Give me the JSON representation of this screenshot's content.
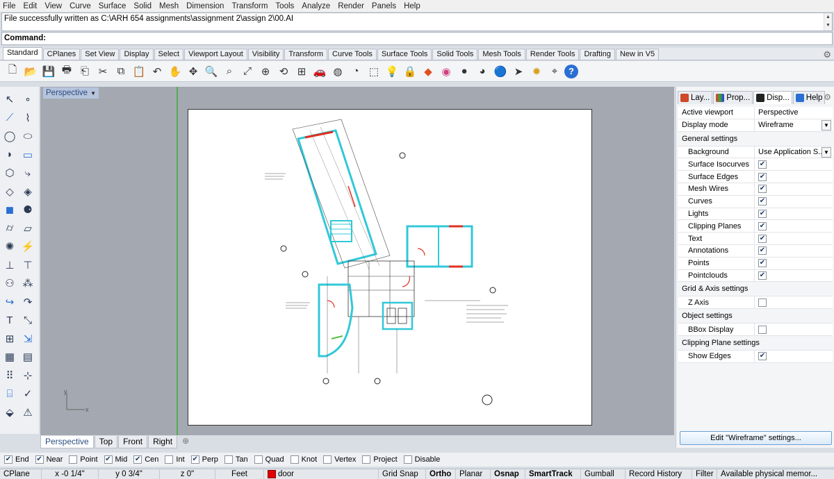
{
  "menu": [
    "File",
    "Edit",
    "View",
    "Curve",
    "Surface",
    "Solid",
    "Mesh",
    "Dimension",
    "Transform",
    "Tools",
    "Analyze",
    "Render",
    "Panels",
    "Help"
  ],
  "command_history": "File successfully written as C:\\ARH 654 assignments\\assignment 2\\assign 2\\00.AI",
  "command_prompt": "Command:",
  "toolbar_tabs": [
    "Standard",
    "CPlanes",
    "Set View",
    "Display",
    "Select",
    "Viewport Layout",
    "Visibility",
    "Transform",
    "Curve Tools",
    "Surface Tools",
    "Solid Tools",
    "Mesh Tools",
    "Render Tools",
    "Drafting",
    "New in V5"
  ],
  "toolbar_icons": [
    "new-icon",
    "open-icon",
    "save-icon",
    "print-icon",
    "import-icon",
    "cut-icon",
    "copy-icon",
    "paste-icon",
    "undo-icon",
    "pan-icon",
    "move-icon",
    "zoom-icon",
    "zoom-window-icon",
    "zoom-extents-icon",
    "zoom-selected-icon",
    "rotate-view-icon",
    "four-viewports-icon",
    "car-icon",
    "options-icon",
    "analysis-icon",
    "select-icon",
    "light-icon",
    "lock-icon",
    "layer-icon",
    "color-wheel-icon",
    "shaded-icon",
    "rendered-icon",
    "render-icon",
    "arrow-icon",
    "settings-icon",
    "gumball-icon",
    "help-icon"
  ],
  "viewport": {
    "active_label": "Perspective",
    "tabs": [
      "Perspective",
      "Top",
      "Front",
      "Right"
    ],
    "axis_x": "x",
    "axis_y": "y"
  },
  "panel": {
    "tabs": [
      "Lay...",
      "Prop...",
      "Disp...",
      "Help"
    ],
    "rows": [
      {
        "type": "prop",
        "label": "Active viewport",
        "value": "Perspective"
      },
      {
        "type": "prop",
        "label": "Display mode",
        "value": "Wireframe",
        "dropdown": true
      },
      {
        "type": "head",
        "label": "General settings"
      },
      {
        "type": "prop",
        "label": "Background",
        "value": "Use Application S...",
        "dropdown": true,
        "sub": true
      },
      {
        "type": "check",
        "label": "Surface Isocurves",
        "checked": true
      },
      {
        "type": "check",
        "label": "Surface Edges",
        "checked": true
      },
      {
        "type": "check",
        "label": "Mesh Wires",
        "checked": true
      },
      {
        "type": "check",
        "label": "Curves",
        "checked": true
      },
      {
        "type": "check",
        "label": "Lights",
        "checked": true
      },
      {
        "type": "check",
        "label": "Clipping Planes",
        "checked": true
      },
      {
        "type": "check",
        "label": "Text",
        "checked": true
      },
      {
        "type": "check",
        "label": "Annotations",
        "checked": true
      },
      {
        "type": "check",
        "label": "Points",
        "checked": true
      },
      {
        "type": "check",
        "label": "Pointclouds",
        "checked": true
      },
      {
        "type": "head",
        "label": "Grid & Axis settings"
      },
      {
        "type": "check",
        "label": "Z Axis",
        "checked": false
      },
      {
        "type": "head",
        "label": "Object settings"
      },
      {
        "type": "check",
        "label": "BBox Display",
        "checked": false
      },
      {
        "type": "head",
        "label": "Clipping Plane settings"
      },
      {
        "type": "check",
        "label": "Show Edges",
        "checked": true
      }
    ],
    "edit_button": "Edit \"Wireframe\" settings..."
  },
  "osnaps": [
    {
      "label": "End",
      "checked": true
    },
    {
      "label": "Near",
      "checked": true
    },
    {
      "label": "Point",
      "checked": false
    },
    {
      "label": "Mid",
      "checked": true
    },
    {
      "label": "Cen",
      "checked": true
    },
    {
      "label": "Int",
      "checked": false
    },
    {
      "label": "Perp",
      "checked": true
    },
    {
      "label": "Tan",
      "checked": false
    },
    {
      "label": "Quad",
      "checked": false
    },
    {
      "label": "Knot",
      "checked": false
    },
    {
      "label": "Vertex",
      "checked": false
    },
    {
      "label": "Project",
      "checked": false
    },
    {
      "label": "Disable",
      "checked": false
    }
  ],
  "status": {
    "cplane": "CPlane",
    "x": "x -0 1/4\"",
    "y": "y 0 3/4\"",
    "z": "z 0\"",
    "units": "Feet",
    "layer": "door",
    "layer_color": "#e00000",
    "grid_snap": "Grid Snap",
    "ortho": "Ortho",
    "planar": "Planar",
    "osnap": "Osnap",
    "smarttrack": "SmartTrack",
    "gumball": "Gumball",
    "record_history": "Record History",
    "filter": "Filter",
    "memory": "Available physical memor..."
  }
}
